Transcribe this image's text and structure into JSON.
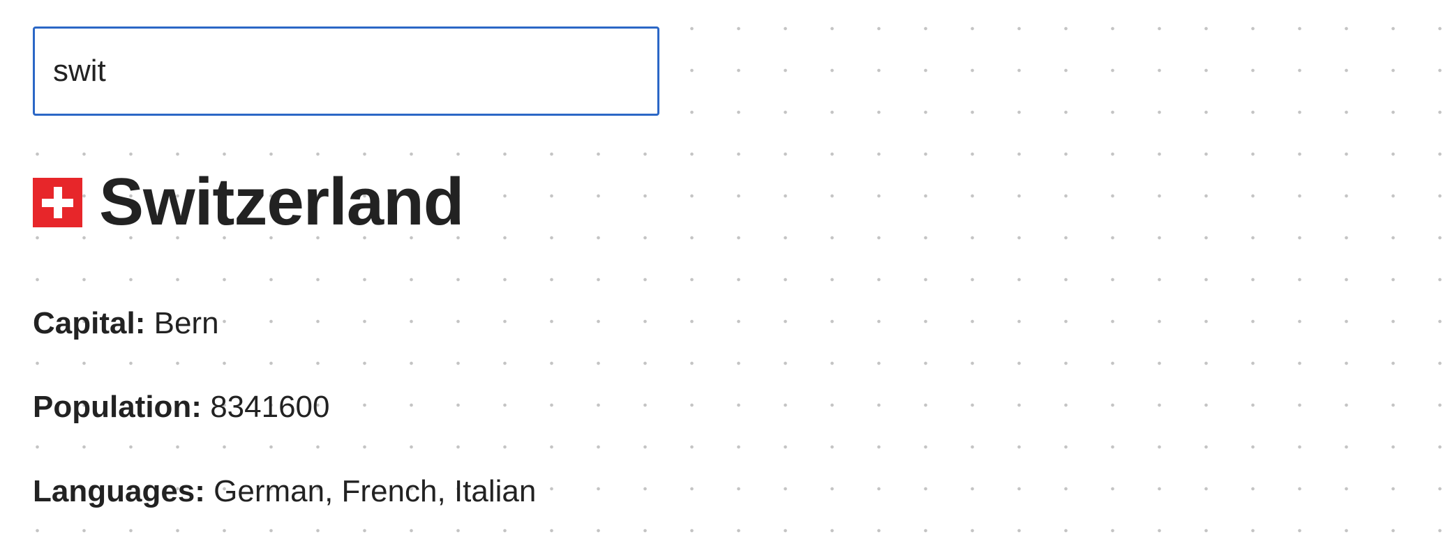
{
  "search": {
    "value": "swit",
    "placeholder": ""
  },
  "country": {
    "flag_icon": "swiss-flag-icon",
    "name": "Switzerland",
    "capital_label": "Capital:",
    "capital": "Bern",
    "population_label": "Population:",
    "population": "8341600",
    "languages_label": "Languages:",
    "languages": "German, French, Italian"
  },
  "colors": {
    "input_border": "#2b67c6",
    "flag_red": "#e7262a",
    "text": "#222222",
    "dot_grid": "#c4c4c4"
  }
}
